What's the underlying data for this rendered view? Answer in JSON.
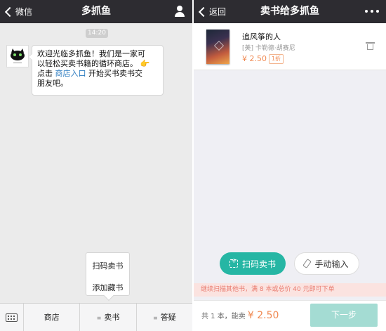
{
  "left": {
    "header": {
      "back_label": "微信",
      "title": "多抓鱼"
    },
    "chat": {
      "time": "14:20",
      "message": {
        "line1": "欢迎光临多抓鱼！我们是一家可",
        "line2": "以轻松买卖书籍的循环商店。",
        "hand_emoji": "👉",
        "line3_prefix": "点击",
        "link_text": "商店入口",
        "line3_suffix": "开始买书卖书交",
        "line4": "朋友吧。"
      }
    },
    "popup_menu": {
      "items": [
        "扫码卖书",
        "添加藏书"
      ]
    },
    "menu_bar": {
      "items": [
        {
          "label": "商店",
          "has_lines": false
        },
        {
          "label": "卖书",
          "has_lines": true
        },
        {
          "label": "答疑",
          "has_lines": true
        }
      ],
      "lines_glyph": "≡"
    }
  },
  "right": {
    "header": {
      "back_label": "返回",
      "title": "卖书给多抓鱼"
    },
    "book": {
      "title": "追风筝的人",
      "author": "[美] 卡勒德·胡赛尼",
      "price": "¥ 2.50",
      "discount": "1折"
    },
    "buttons": {
      "scan": "扫码卖书",
      "manual": "手动输入"
    },
    "notice": "继续扫描其他书，满 8 本或总价 40 元即可下单",
    "summary": {
      "count_text": "共 1 本，能卖",
      "amount": "¥ 2.50"
    },
    "next_button": "下一步"
  },
  "colors": {
    "header_bg": "#2d2c31",
    "teal": "#26b6a4",
    "price_orange": "#f08a53",
    "link_blue": "#2a7abf"
  },
  "icons": [
    "person-icon",
    "more-icon",
    "keyboard-icon",
    "trash-icon",
    "scan-icon",
    "eraser-icon",
    "cat-logo-icon"
  ]
}
